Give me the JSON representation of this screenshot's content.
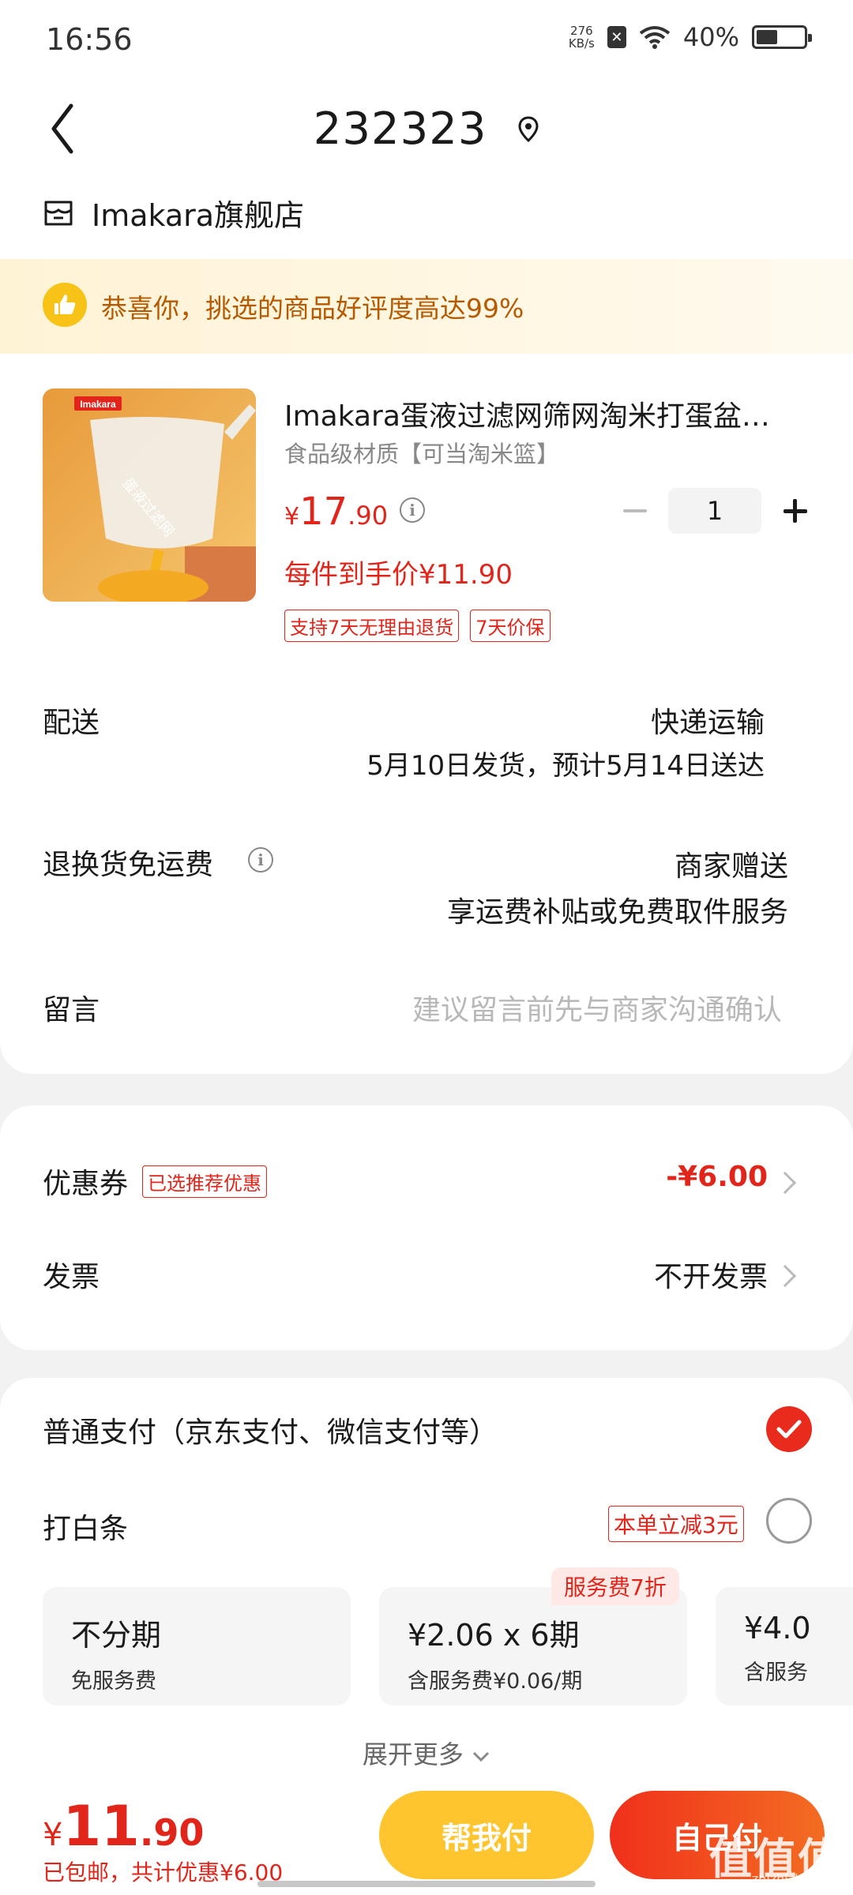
{
  "status_bar": {
    "time": "16:56",
    "net_speed_top": "276",
    "net_speed_bottom": "KB/s",
    "battery": "40%"
  },
  "header": {
    "title": "232323"
  },
  "shop": {
    "name": "Imakara旗舰店"
  },
  "banner": {
    "text": "恭喜你，挑选的商品好评度高达99%"
  },
  "product": {
    "title": "Imakara蛋液过滤网筛网淘米打蛋盆…",
    "subtitle": "食品级材质【可当淘米篮】",
    "price_currency": "¥",
    "price_int": "17",
    "price_dec": ".90",
    "unit_price": "每件到手价¥11.90",
    "quantity": "1",
    "tags": [
      "支持7天无理由退货",
      "7天价保"
    ],
    "image_brand": "Imakara",
    "image_caption": "蛋液过滤网"
  },
  "delivery": {
    "label": "配送",
    "method": "快递运输",
    "schedule": "5月10日发货，预计5月14日送达"
  },
  "return_shipping": {
    "label": "退换货免运费",
    "value": "商家赠送",
    "detail": "享运费补贴或免费取件服务"
  },
  "message": {
    "label": "留言",
    "placeholder": "建议留言前先与商家沟通确认"
  },
  "coupon": {
    "label": "优惠券",
    "tag": "已选推荐优惠",
    "value": "-¥6.00"
  },
  "invoice": {
    "label": "发票",
    "value": "不开发票"
  },
  "payment": {
    "normal_label": "普通支付（京东支付、微信支付等）",
    "baitiao_label": "打白条",
    "baitiao_tag": "本单立减3元",
    "plans": [
      {
        "title": "不分期",
        "sub": "免服务费"
      },
      {
        "title": "¥2.06 x 6期",
        "sub": "含服务费¥0.06/期",
        "badge": "服务费7折"
      },
      {
        "title": "¥4.0",
        "sub": "含服务"
      }
    ],
    "expand": "展开更多"
  },
  "bottom": {
    "total_currency": "¥",
    "total_int": "11",
    "total_dec": ".90",
    "shipping_free": "已包邮",
    "discount_text": "，共计优惠¥6.00",
    "help_pay": "帮我付",
    "self_pay": "自己付"
  },
  "watermark": {
    "main": "值值值",
    "sub": "zhizhizhi.com"
  },
  "colors": {
    "accent_red": "#e1251b",
    "help_button": "#ffc52e",
    "banner_text": "#b55a00"
  }
}
